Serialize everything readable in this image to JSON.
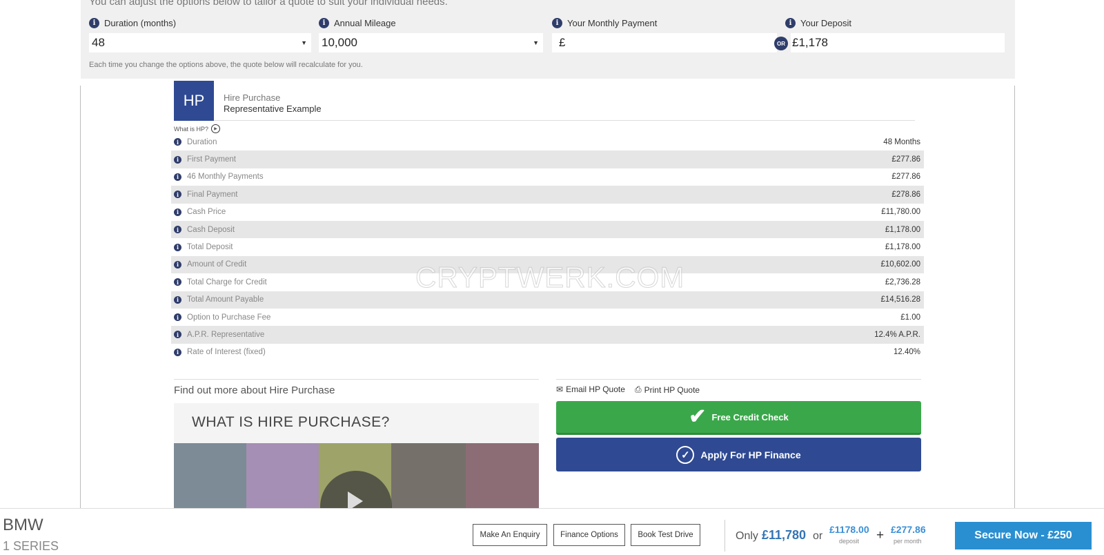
{
  "options": {
    "intro": "You can adjust the options below to tailor a quote to suit your individual needs.",
    "duration": {
      "label": "Duration (months)",
      "value": "48"
    },
    "mileage": {
      "label": "Annual Mileage",
      "value": "10,000"
    },
    "monthly_payment": {
      "label": "Your Monthly Payment",
      "currency": "£",
      "value": ""
    },
    "deposit": {
      "label": "Your Deposit",
      "value": "£1,178"
    },
    "or_badge": "OR",
    "recalc_note": "Each time you change the options above, the quote below will recalculate for you."
  },
  "hp": {
    "logo": "HP",
    "title": "Hire Purchase",
    "subtitle": "Representative Example",
    "what_is": "What is HP?",
    "rows": [
      {
        "label": "Duration",
        "value": "48 Months"
      },
      {
        "label": "First Payment",
        "value": "£277.86"
      },
      {
        "label": "46 Monthly Payments",
        "value": "£277.86"
      },
      {
        "label": "Final Payment",
        "value": "£278.86"
      },
      {
        "label": "Cash Price",
        "value": "£11,780.00"
      },
      {
        "label": "Cash Deposit",
        "value": "£1,178.00"
      },
      {
        "label": "Total Deposit",
        "value": "£1,178.00"
      },
      {
        "label": "Amount of Credit",
        "value": "£10,602.00"
      },
      {
        "label": "Total Charge for Credit",
        "value": "£2,736.28"
      },
      {
        "label": "Total Amount Payable",
        "value": "£14,516.28"
      },
      {
        "label": "Option to Purchase Fee",
        "value": "£1.00"
      },
      {
        "label": "A.P.R. Representative",
        "value": "12.4% A.P.R."
      },
      {
        "label": "Rate of Interest (fixed)",
        "value": "12.40%"
      }
    ]
  },
  "watermark": "CRYPTWERK.COM",
  "find_more": {
    "heading": "Find out more about Hire Purchase",
    "video_title": "WHAT IS HIRE PURCHASE?"
  },
  "quote_actions": {
    "email": "Email HP Quote",
    "print": "Print HP Quote",
    "credit_check": "Free Credit Check",
    "apply": "Apply For HP Finance"
  },
  "bottom_bar": {
    "make": "BMW",
    "model": "1 SERIES",
    "enquiry": "Make An Enquiry",
    "finance_options": "Finance Options",
    "test_drive": "Book Test Drive",
    "only": "Only",
    "cash_price": "£11,780",
    "or": "or",
    "deposit": "£1178.00",
    "deposit_sub": "deposit",
    "plus": "+",
    "monthly": "£277.86",
    "monthly_sub": "per month",
    "secure": "Secure Now - £250"
  },
  "colors": {
    "brand_navy": "#2f4a93",
    "credit_green": "#3aa84a",
    "accent_blue": "#2a8fd1"
  }
}
